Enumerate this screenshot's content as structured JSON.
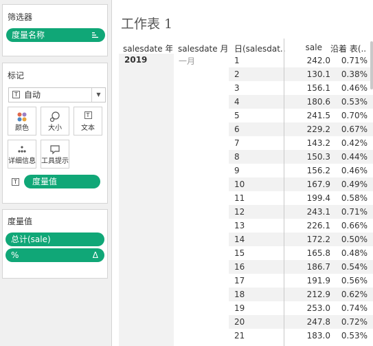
{
  "filters": {
    "title": "筛选器",
    "pill_label": "度量名称"
  },
  "marks": {
    "title": "标记",
    "mark_type": "自动",
    "buttons": [
      {
        "label": "颜色",
        "icon": "color-dots-icon"
      },
      {
        "label": "大小",
        "icon": "size-icon"
      },
      {
        "label": "文本",
        "icon": "text-icon"
      },
      {
        "label": "详细信息",
        "icon": "detail-icon"
      },
      {
        "label": "工具提示",
        "icon": "tooltip-icon"
      }
    ],
    "text_pill": "度量值"
  },
  "measure_values": {
    "title": "度量值",
    "pills": [
      "总计(sale)",
      "%"
    ]
  },
  "sheet": {
    "title": "工作表 1",
    "headers": [
      "salesdate 年",
      "salesdate 月",
      "日(salesdat..",
      "sale",
      "沿着 表(.."
    ],
    "year": "2019",
    "month": "一月",
    "rows": [
      {
        "day": "1",
        "sale": "242.0",
        "pct": "0.71%"
      },
      {
        "day": "2",
        "sale": "130.1",
        "pct": "0.38%"
      },
      {
        "day": "3",
        "sale": "156.1",
        "pct": "0.46%"
      },
      {
        "day": "4",
        "sale": "180.6",
        "pct": "0.53%"
      },
      {
        "day": "5",
        "sale": "241.5",
        "pct": "0.70%"
      },
      {
        "day": "6",
        "sale": "229.2",
        "pct": "0.67%"
      },
      {
        "day": "7",
        "sale": "143.2",
        "pct": "0.42%"
      },
      {
        "day": "8",
        "sale": "150.3",
        "pct": "0.44%"
      },
      {
        "day": "9",
        "sale": "156.2",
        "pct": "0.46%"
      },
      {
        "day": "10",
        "sale": "167.9",
        "pct": "0.49%"
      },
      {
        "day": "11",
        "sale": "199.4",
        "pct": "0.58%"
      },
      {
        "day": "12",
        "sale": "243.1",
        "pct": "0.71%"
      },
      {
        "day": "13",
        "sale": "226.1",
        "pct": "0.66%"
      },
      {
        "day": "14",
        "sale": "172.2",
        "pct": "0.50%"
      },
      {
        "day": "15",
        "sale": "165.8",
        "pct": "0.48%"
      },
      {
        "day": "16",
        "sale": "186.7",
        "pct": "0.54%"
      },
      {
        "day": "17",
        "sale": "191.9",
        "pct": "0.56%"
      },
      {
        "day": "18",
        "sale": "212.9",
        "pct": "0.62%"
      },
      {
        "day": "19",
        "sale": "253.0",
        "pct": "0.74%"
      },
      {
        "day": "20",
        "sale": "247.8",
        "pct": "0.72%"
      },
      {
        "day": "21",
        "sale": "183.0",
        "pct": "0.53%"
      }
    ]
  },
  "colors": {
    "pill": "#10a777",
    "panel_bg": "#f0f0f0"
  }
}
